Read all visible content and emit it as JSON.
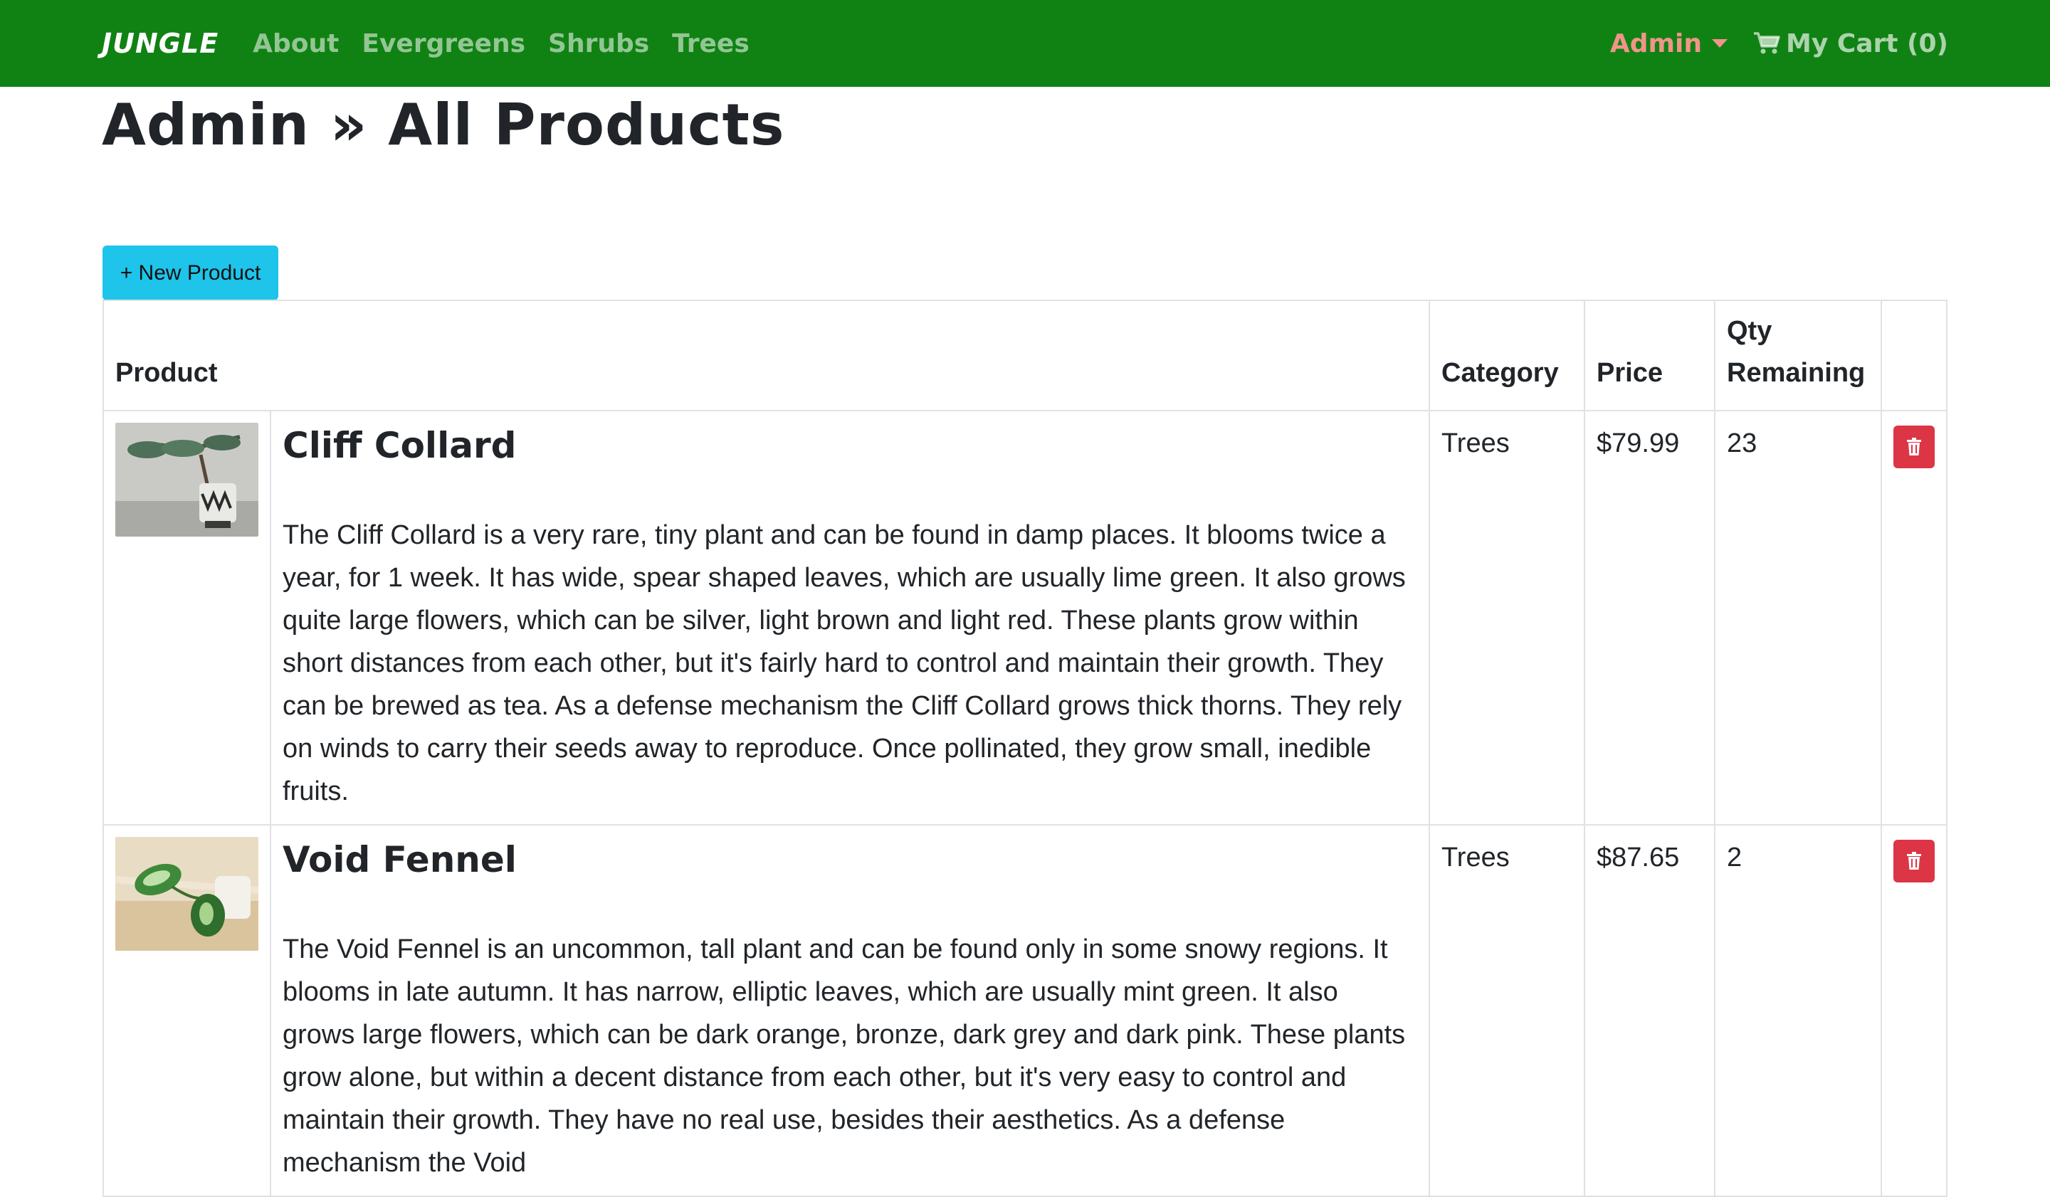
{
  "nav": {
    "brand": "JUNGLE",
    "links": [
      "About",
      "Evergreens",
      "Shrubs",
      "Trees"
    ],
    "admin_label": "Admin",
    "cart_label": "My Cart (0)",
    "bg_color": "#108213",
    "admin_color": "#f1948a"
  },
  "page": {
    "title": "Admin » All Products",
    "new_button_label": "+ New Product"
  },
  "table": {
    "headers": {
      "product": "Product",
      "category": "Category",
      "price": "Price",
      "qty": "Qty Remaining"
    },
    "rows": [
      {
        "name": "Cliff Collard",
        "description": "The Cliff Collard is a very rare, tiny plant and can be found in damp places. It blooms twice a year, for 1 week. It has wide, spear shaped leaves, which are usually lime green. It also grows quite large flowers, which can be silver, light brown and light red. These plants grow within short distances from each other, but it's fairly hard to control and maintain their growth. They can be brewed as tea. As a defense mechanism the Cliff Collard grows thick thorns. They rely on winds to carry their seeds away to reproduce. Once pollinated, they grow small, inedible fruits.",
        "category": "Trees",
        "price": "$79.99",
        "qty": "23"
      },
      {
        "name": "Void Fennel",
        "description": "The Void Fennel is an uncommon, tall plant and can be found only in some snowy regions. It blooms in late autumn. It has narrow, elliptic leaves, which are usually mint green. It also grows large flowers, which can be dark orange, bronze, dark grey and dark pink. These plants grow alone, but within a decent distance from each other, but it's very easy to control and maintain their growth. They have no real use, besides their aesthetics. As a defense mechanism the Void",
        "category": "Trees",
        "price": "$87.65",
        "qty": "2"
      }
    ]
  },
  "colors": {
    "new_button": "#1ec4ea",
    "delete_button": "#dc3545"
  }
}
